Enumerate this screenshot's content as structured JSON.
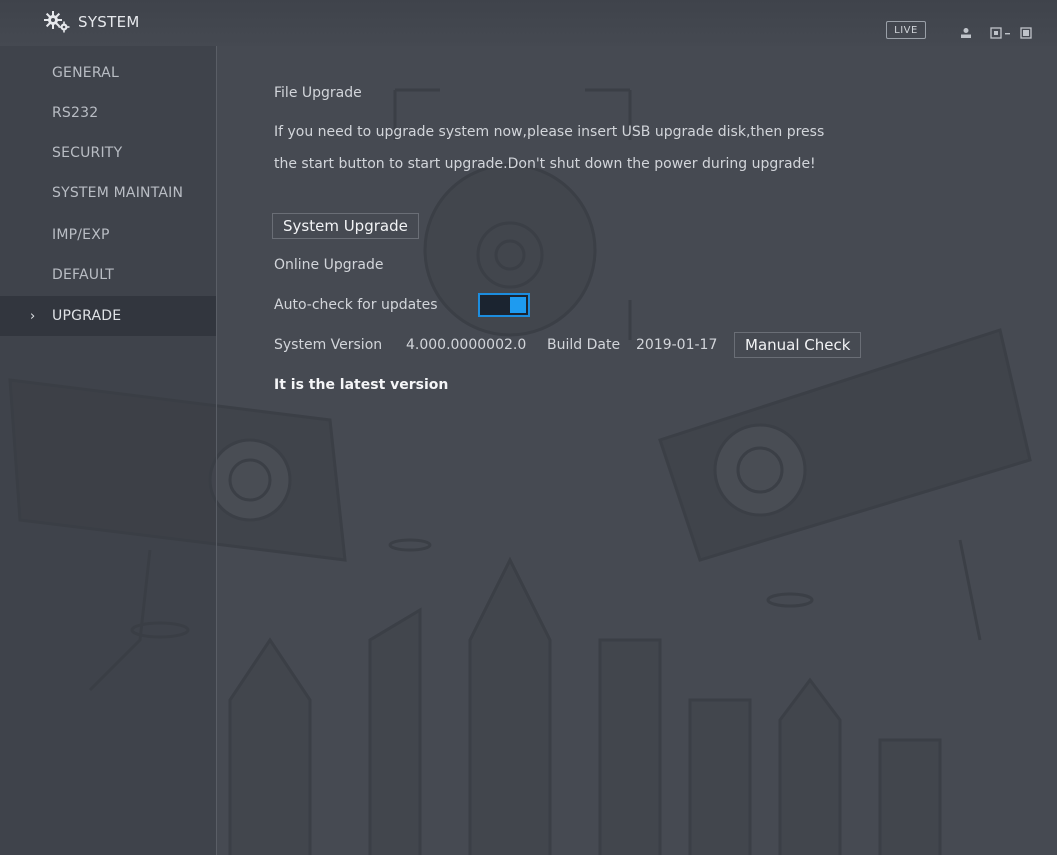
{
  "header": {
    "title": "SYSTEM",
    "live_label": "LIVE",
    "icons": [
      "gear-icon",
      "user-icon",
      "display-icon",
      "exit-icon"
    ]
  },
  "sidebar": {
    "items": [
      {
        "label": "GENERAL",
        "active": false
      },
      {
        "label": "RS232",
        "active": false
      },
      {
        "label": "SECURITY",
        "active": false
      },
      {
        "label": "SYSTEM MAINTAIN",
        "active": false
      },
      {
        "label": "IMP/EXP",
        "active": false
      },
      {
        "label": "DEFAULT",
        "active": false
      },
      {
        "label": "UPGRADE",
        "active": true
      }
    ],
    "active_marker": "›"
  },
  "main": {
    "file_upgrade_heading": "File Upgrade",
    "instructions_line1": "If you need to upgrade system now,please insert USB upgrade disk,then press",
    "instructions_line2": "the start button to start upgrade.Don't shut down the power during upgrade!",
    "system_upgrade_button": "System Upgrade",
    "online_upgrade_heading": "Online Upgrade",
    "auto_check_label": "Auto-check for updates",
    "auto_check_enabled": true,
    "system_version_label": "System Version",
    "system_version_value": "4.000.0000002.0",
    "build_date_label": "Build Date",
    "build_date_value": "2019-01-17",
    "manual_check_button": "Manual Check",
    "status_message": "It is the latest version"
  },
  "colors": {
    "background": "#464a52",
    "toggle_accent": "#1e9bf0"
  }
}
